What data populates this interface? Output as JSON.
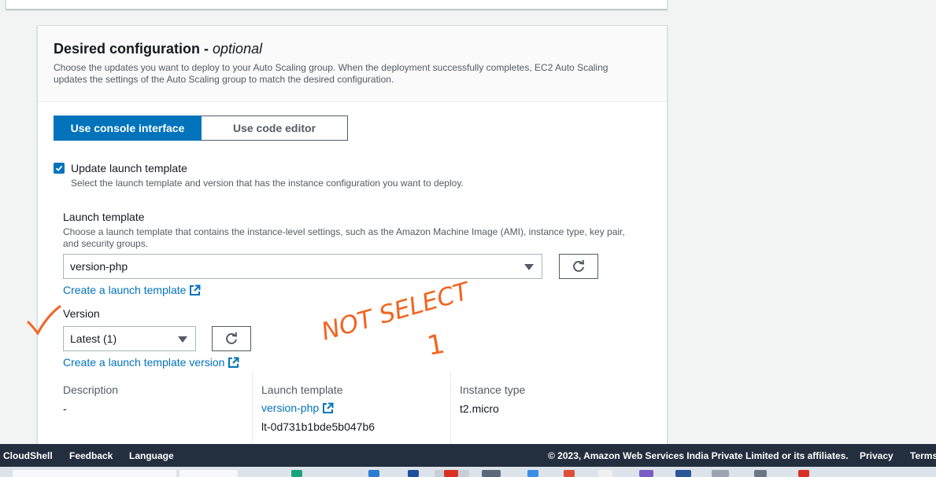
{
  "section": {
    "title": "Desired configuration - ",
    "title_optional": "optional",
    "description": "Choose the updates you want to deploy to your Auto Scaling group. When the deployment successfully completes, EC2 Auto Scaling updates the settings of the Auto Scaling group to match the desired configuration."
  },
  "mode_toggle": {
    "console_label": "Use console interface",
    "code_label": "Use code editor"
  },
  "update_template": {
    "checked": true,
    "label": "Update launch template",
    "description": "Select the launch template and version that has the instance configuration you want to deploy."
  },
  "launch_template": {
    "label": "Launch template",
    "description": "Choose a launch template that contains the instance-level settings, such as the Amazon Machine Image (AMI), instance type, key pair, and security groups.",
    "selected": "version-php",
    "create_link": "Create a launch template"
  },
  "version": {
    "label": "Version",
    "selected": "Latest (1)",
    "create_link": "Create a launch template version"
  },
  "details": {
    "description_label": "Description",
    "description_value": "-",
    "template_label": "Launch template",
    "template_name": "version-php",
    "template_id": "lt-0d731b1bde5b047b6",
    "instance_type_label": "Instance type",
    "instance_type_value": "t2.micro"
  },
  "annotation": {
    "text_line1": "NOT SELECT",
    "text_line2": "1",
    "color": "#f26522"
  },
  "footer": {
    "cloudshell": "CloudShell",
    "feedback": "Feedback",
    "language": "Language",
    "copyright": "© 2023, Amazon Web Services India Private Limited or its affiliates.",
    "privacy": "Privacy",
    "terms": "Terms"
  },
  "colors": {
    "primary": "#0073bb",
    "footer_bg": "#232f3e"
  }
}
